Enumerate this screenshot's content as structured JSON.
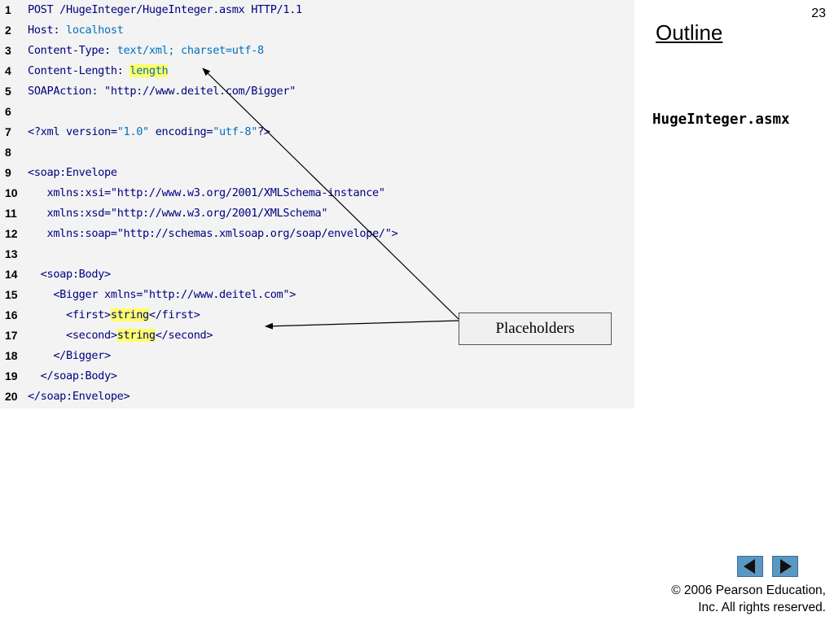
{
  "slide": {
    "page_number": "23",
    "outline_label": "Outline",
    "side_label": "HugeInteger.asmx",
    "callout_label": "Placeholders",
    "copyright_line1": "© 2006 Pearson Education,",
    "copyright_line2": "Inc.  All rights reserved."
  },
  "code": [
    {
      "n": "1",
      "indent": "",
      "tokens": [
        {
          "t": "POST /HugeInteger/HugeInteger.asmx HTTP/1.1",
          "c": "k"
        }
      ]
    },
    {
      "n": "2",
      "indent": "",
      "tokens": [
        {
          "t": "Host: ",
          "c": "k"
        },
        {
          "t": "localhost",
          "c": "v"
        }
      ]
    },
    {
      "n": "3",
      "indent": "",
      "tokens": [
        {
          "t": "Content-Type: ",
          "c": "k"
        },
        {
          "t": "text/xml; charset=utf-8",
          "c": "v"
        }
      ]
    },
    {
      "n": "4",
      "indent": "",
      "tokens": [
        {
          "t": "Content-Length: ",
          "c": "k"
        },
        {
          "t": "length",
          "c": "v",
          "hl": true
        }
      ]
    },
    {
      "n": "5",
      "indent": "",
      "tokens": [
        {
          "t": "SOAPAction: ",
          "c": "k"
        },
        {
          "t": "\"http://www.deitel.com/Bigger\"",
          "c": "k"
        }
      ]
    },
    {
      "n": "6",
      "indent": "",
      "tokens": []
    },
    {
      "n": "7",
      "indent": "",
      "tokens": [
        {
          "t": "<?xml version=",
          "c": "k"
        },
        {
          "t": "\"1.0\"",
          "c": "v"
        },
        {
          "t": " encoding=",
          "c": "k"
        },
        {
          "t": "\"utf-8\"",
          "c": "v"
        },
        {
          "t": "?>",
          "c": "k"
        }
      ]
    },
    {
      "n": "8",
      "indent": "",
      "tokens": []
    },
    {
      "n": "9",
      "indent": "",
      "tokens": [
        {
          "t": "<soap:Envelope",
          "c": "k"
        }
      ]
    },
    {
      "n": "10",
      "indent": "   ",
      "tokens": [
        {
          "t": "xmlns:xsi=",
          "c": "k"
        },
        {
          "t": "\"http://www.w3.org/2001/XMLSchema-instance\"",
          "c": "k"
        }
      ]
    },
    {
      "n": "11",
      "indent": "   ",
      "tokens": [
        {
          "t": "xmlns:xsd=",
          "c": "k"
        },
        {
          "t": "\"http://www.w3.org/2001/XMLSchema\"",
          "c": "k"
        }
      ]
    },
    {
      "n": "12",
      "indent": "   ",
      "tokens": [
        {
          "t": "xmlns:soap=",
          "c": "k"
        },
        {
          "t": "\"http://schemas.xmlsoap.org/soap/envelope/\"",
          "c": "k"
        },
        {
          "t": ">",
          "c": "k"
        }
      ]
    },
    {
      "n": "13",
      "indent": "",
      "tokens": []
    },
    {
      "n": "14",
      "indent": "  ",
      "tokens": [
        {
          "t": "<soap:Body>",
          "c": "k"
        }
      ]
    },
    {
      "n": "15",
      "indent": "    ",
      "tokens": [
        {
          "t": "<Bigger xmlns=",
          "c": "k"
        },
        {
          "t": "\"http://www.deitel.com\"",
          "c": "k"
        },
        {
          "t": ">",
          "c": "k"
        }
      ]
    },
    {
      "n": "16",
      "indent": "      ",
      "tokens": [
        {
          "t": "<first>",
          "c": "k"
        },
        {
          "t": "string",
          "c": "k",
          "hl": true
        },
        {
          "t": "</first>",
          "c": "k"
        }
      ]
    },
    {
      "n": "17",
      "indent": "      ",
      "tokens": [
        {
          "t": "<second>",
          "c": "k"
        },
        {
          "t": "string",
          "c": "k",
          "hl": true
        },
        {
          "t": "</second>",
          "c": "k"
        }
      ]
    },
    {
      "n": "18",
      "indent": "    ",
      "tokens": [
        {
          "t": "</Bigger>",
          "c": "k"
        }
      ]
    },
    {
      "n": "19",
      "indent": "  ",
      "tokens": [
        {
          "t": "</soap:Body>",
          "c": "k"
        }
      ]
    },
    {
      "n": "20",
      "indent": "",
      "tokens": [
        {
          "t": "</soap:Envelope>",
          "c": "k"
        }
      ]
    }
  ],
  "colors": {
    "keyword": "#000080",
    "value": "#0070c0",
    "highlight": "#ffff66",
    "nav_button": "#5b97c3"
  },
  "icons": {
    "prev": "triangle-left-icon",
    "next": "triangle-right-icon"
  }
}
